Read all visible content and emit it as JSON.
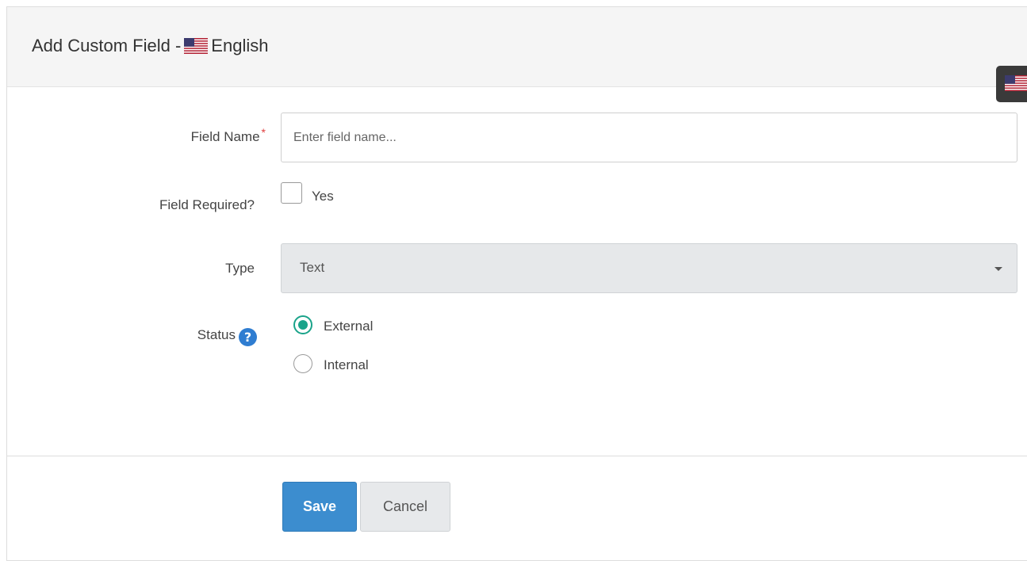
{
  "panel": {
    "title_prefix": "Add Custom Field - ",
    "language": "English",
    "flag_icon": "us-flag-icon"
  },
  "form": {
    "field_name": {
      "label": "Field Name",
      "required_marker": "*",
      "placeholder": "Enter field name...",
      "value": ""
    },
    "field_required": {
      "label": "Field Required?",
      "option_label": "Yes",
      "checked": false
    },
    "type": {
      "label": "Type",
      "selected": "Text"
    },
    "status": {
      "label": "Status",
      "help_icon": "question-circle-icon",
      "options": [
        {
          "label": "External",
          "checked": true
        },
        {
          "label": "Internal",
          "checked": false
        }
      ]
    }
  },
  "actions": {
    "save_label": "Save",
    "cancel_label": "Cancel"
  },
  "colors": {
    "primary": "#3c8dcf",
    "radio_accent": "#1aa38a",
    "required": "#e04040",
    "help": "#2f7dd1"
  }
}
